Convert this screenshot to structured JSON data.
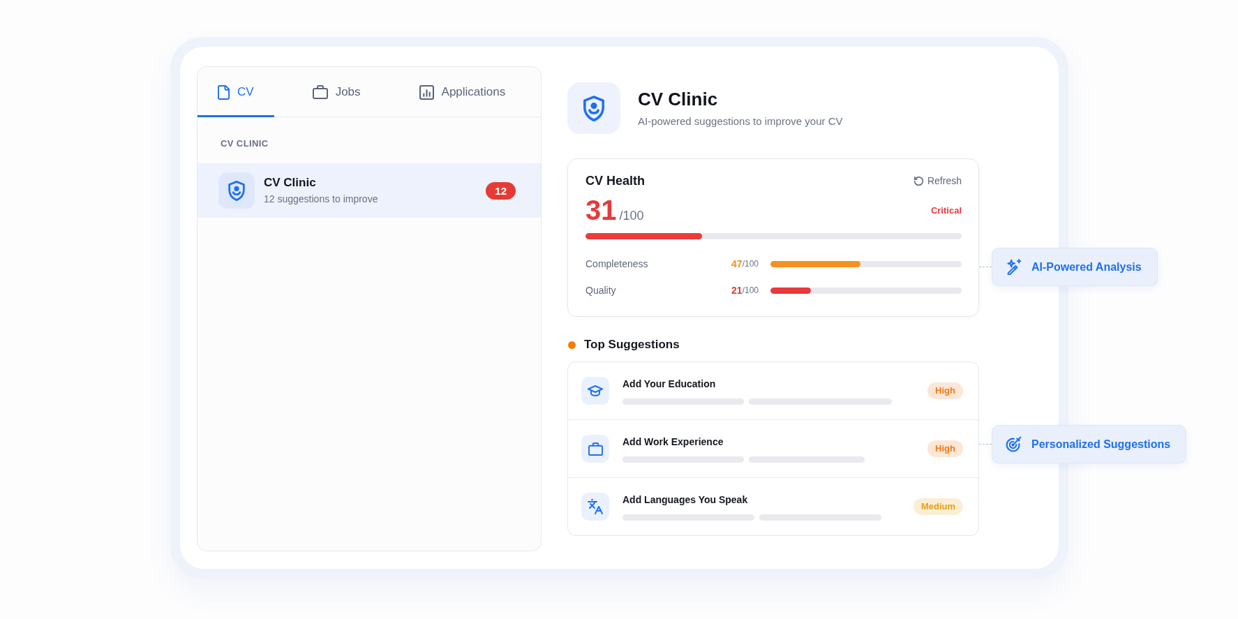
{
  "tabs": [
    {
      "label": "CV",
      "selected": true
    },
    {
      "label": "Jobs",
      "selected": false
    },
    {
      "label": "Applications",
      "selected": false
    }
  ],
  "sidebar": {
    "section_label": "CV CLINIC",
    "items": [
      {
        "title": "CV Clinic",
        "subtitle": "12 suggestions to improve",
        "badge": "12",
        "selected": true
      }
    ]
  },
  "header": {
    "title": "CV Clinic",
    "subtitle": "AI-powered suggestions to improve your CV"
  },
  "health": {
    "title": "CV Health",
    "refresh": "Refresh",
    "score": "31",
    "max": "/100",
    "status": "Critical",
    "level": 0.31,
    "metrics": [
      {
        "label": "Completeness",
        "score": "47",
        "max": "/100",
        "color": "#f5901e",
        "level": 0.47
      },
      {
        "label": "Quality",
        "score": "21",
        "max": "/100",
        "color": "#e8393b",
        "level": 0.21
      }
    ]
  },
  "suggestions": {
    "title": "Top Suggestions",
    "items": [
      {
        "title": "Add Your Education",
        "priority": "High",
        "color": "#f07a1a"
      },
      {
        "title": "Add Work Experience",
        "priority": "High",
        "color": "#f07a1a"
      },
      {
        "title": "Add Languages You Speak",
        "priority": "Medium",
        "color": "#eb9e12"
      }
    ]
  },
  "callouts": [
    {
      "label": "AI-Powered Analysis"
    },
    {
      "label": "Personalized Suggestions"
    }
  ]
}
